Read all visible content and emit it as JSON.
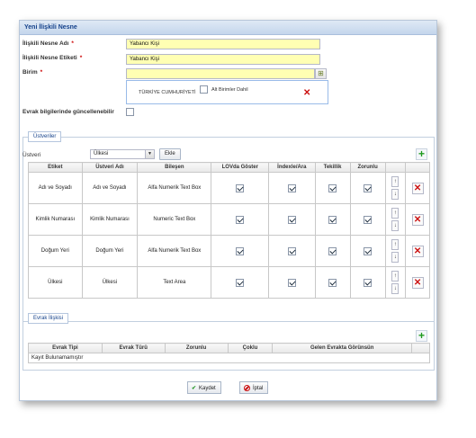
{
  "window": {
    "title": "Yeni İlişkili Nesne"
  },
  "form": {
    "name_label": "İlişkili Nesne Adı",
    "name_value": "Yabancı Kişi",
    "tag_label": "İlişkili Nesne Etiketi",
    "tag_value": "Yabancı Kişi",
    "unit_label": "Birim",
    "unit_value": "",
    "required_mark": "*",
    "update_label": "Evrak bilgilerinde güncellenebilir"
  },
  "unit_popup": {
    "org_name": "TÜRKİYE CUMHURİYETİ",
    "sub_units_label": "Alt Birimler Dahil"
  },
  "parents": {
    "legend": "Üstveriler",
    "select_label": "Üstveri",
    "select_value": "Ülkesi",
    "add_label": "Ekle",
    "columns": [
      "Etiket",
      "Üstveri Adı",
      "Bileşen",
      "LOVda Göster",
      "İndexle/Ara",
      "Tekillik",
      "Zorunlu"
    ],
    "rows": [
      {
        "label": "Adı ve Soyadı",
        "name": "Adı ve Soyadı",
        "component": "Alfa Numerik Text Box",
        "lov": true,
        "index": true,
        "unique": true,
        "required": true
      },
      {
        "label": "Kimlik Numarası",
        "name": "Kimlik Numarası",
        "component": "Numeric Text Box",
        "lov": true,
        "index": true,
        "unique": true,
        "required": true
      },
      {
        "label": "Doğum Yeri",
        "name": "Doğum Yeri",
        "component": "Alfa Numerik Text Box",
        "lov": true,
        "index": true,
        "unique": true,
        "required": true
      },
      {
        "label": "Ülkesi",
        "name": "Ülkesi",
        "component": "Text Area",
        "lov": true,
        "index": true,
        "unique": true,
        "required": true
      }
    ]
  },
  "relations": {
    "legend": "Evrak İlişkisi",
    "columns": [
      "Evrak Tipi",
      "Evrak Türü",
      "Zorunlu",
      "Çoklu",
      "Gelen Evrakta Görünsün"
    ],
    "empty_text": "Kayıt Bulunamamıştır"
  },
  "footer": {
    "save_label": "Kaydet",
    "cancel_label": "İptal"
  },
  "icons": {
    "add": "plus-icon",
    "delete": "x-icon",
    "up": "arrow-up-icon",
    "down": "arrow-down-icon"
  }
}
